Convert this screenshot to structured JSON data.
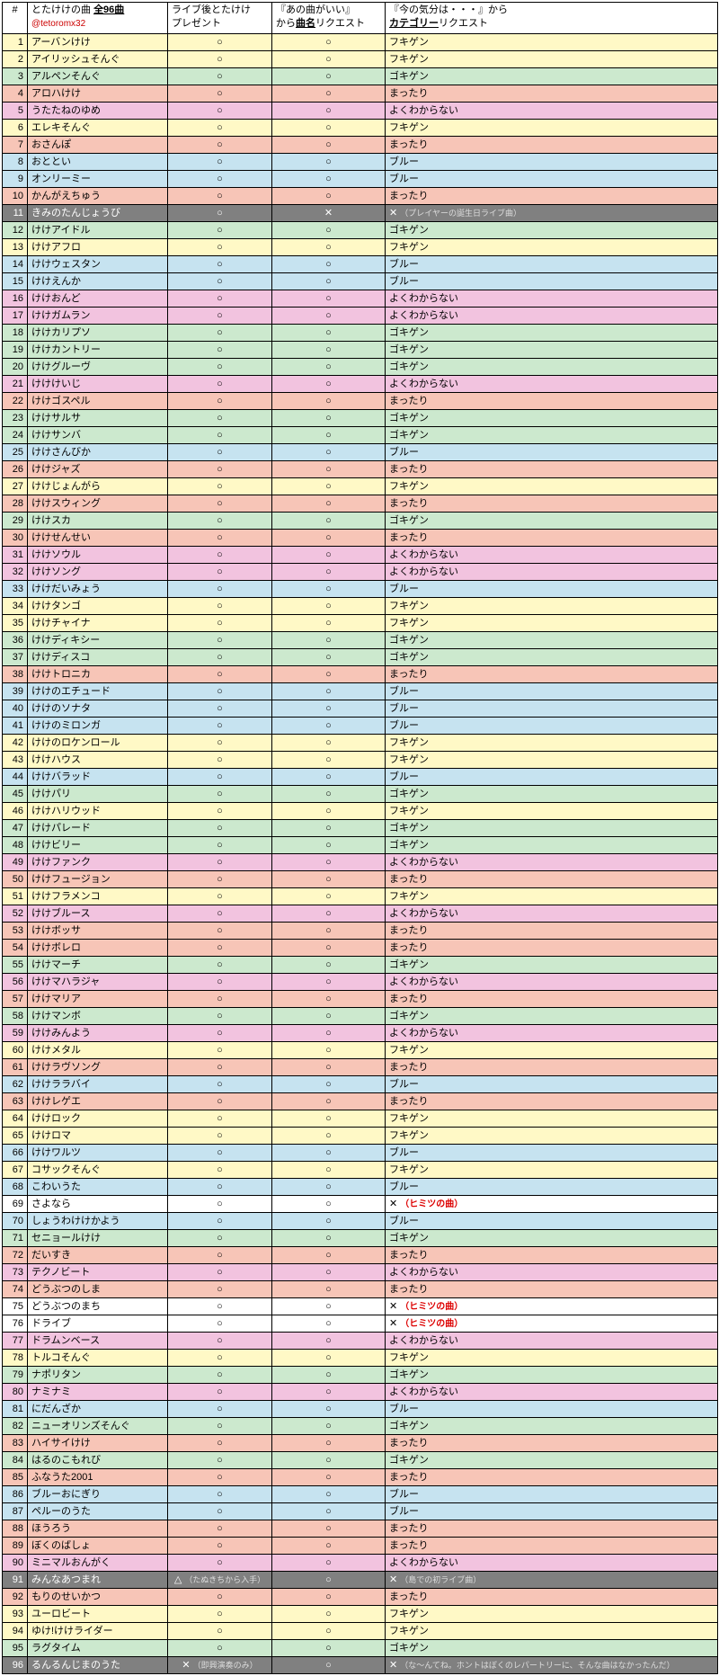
{
  "header": {
    "num": "#",
    "name_l1": "とたけけの曲 ",
    "name_bold": "全96曲",
    "credit": "@tetoromx32",
    "c1_l1": "ライブ後とたけけ",
    "c1_l2": "プレゼント",
    "c2_l1": "『あの曲がいい』",
    "c2_l2_pre": "から",
    "c2_l2_bold": "曲名",
    "c2_l2_post": "リクエスト",
    "c3_l1": "『今の気分は・・・』から",
    "c3_l2_bold": "カテゴリー",
    "c3_l2_post": "リクエスト"
  },
  "marks": {
    "circle": "○",
    "cross": "✕",
    "tri": "△"
  },
  "notes": {
    "birthday": "（プレイヤーの誕生日ライブ曲）",
    "secret": "（ヒミツの曲）",
    "tanuki": "（たぬきちから入手）",
    "first_live": "（島での初ライブ曲）",
    "improv": "（即興演奏のみ）",
    "repertoire": "（な～んてね。ホントはぼくのレパートリーに、そんな曲はなかったんだ）"
  },
  "rows": [
    {
      "n": "1",
      "name": "アーバンけけ",
      "c1": "c",
      "c2": "c",
      "c3": "フキゲン",
      "color": "yellow"
    },
    {
      "n": "2",
      "name": "アイリッシュそんぐ",
      "c1": "c",
      "c2": "c",
      "c3": "フキゲン",
      "color": "yellow"
    },
    {
      "n": "3",
      "name": "アルペンそんぐ",
      "c1": "c",
      "c2": "c",
      "c3": "ゴキゲン",
      "color": "green"
    },
    {
      "n": "4",
      "name": "アロハけけ",
      "c1": "c",
      "c2": "c",
      "c3": "まったり",
      "color": "red"
    },
    {
      "n": "5",
      "name": "うたたねのゆめ",
      "c1": "c",
      "c2": "c",
      "c3": "よくわからない",
      "color": "pink"
    },
    {
      "n": "6",
      "name": "エレキそんぐ",
      "c1": "c",
      "c2": "c",
      "c3": "フキゲン",
      "color": "yellow"
    },
    {
      "n": "7",
      "name": "おさんぽ",
      "c1": "c",
      "c2": "c",
      "c3": "まったり",
      "color": "red"
    },
    {
      "n": "8",
      "name": "おととい",
      "c1": "c",
      "c2": "c",
      "c3": "ブルー",
      "color": "blue"
    },
    {
      "n": "9",
      "name": "オンリーミー",
      "c1": "c",
      "c2": "c",
      "c3": "ブルー",
      "color": "blue"
    },
    {
      "n": "10",
      "name": "かんがえちゅう",
      "c1": "c",
      "c2": "c",
      "c3": "まったり",
      "color": "red"
    },
    {
      "n": "11",
      "name": "きみのたんじょうび",
      "c1": "c",
      "c2": "x",
      "c3": "✕",
      "note": "birthday",
      "color": "grey"
    },
    {
      "n": "12",
      "name": "けけアイドル",
      "c1": "c",
      "c2": "c",
      "c3": "ゴキゲン",
      "color": "green"
    },
    {
      "n": "13",
      "name": "けけアフロ",
      "c1": "c",
      "c2": "c",
      "c3": "フキゲン",
      "color": "yellow"
    },
    {
      "n": "14",
      "name": "けけウェスタン",
      "c1": "c",
      "c2": "c",
      "c3": "ブルー",
      "color": "blue"
    },
    {
      "n": "15",
      "name": "けけえんか",
      "c1": "c",
      "c2": "c",
      "c3": "ブルー",
      "color": "blue"
    },
    {
      "n": "16",
      "name": "けけおんど",
      "c1": "c",
      "c2": "c",
      "c3": "よくわからない",
      "color": "pink"
    },
    {
      "n": "17",
      "name": "けけガムラン",
      "c1": "c",
      "c2": "c",
      "c3": "よくわからない",
      "color": "pink"
    },
    {
      "n": "18",
      "name": "けけカリプソ",
      "c1": "c",
      "c2": "c",
      "c3": "ゴキゲン",
      "color": "green"
    },
    {
      "n": "19",
      "name": "けけカントリー",
      "c1": "c",
      "c2": "c",
      "c3": "ゴキゲン",
      "color": "green"
    },
    {
      "n": "20",
      "name": "けけグルーヴ",
      "c1": "c",
      "c2": "c",
      "c3": "ゴキゲン",
      "color": "green"
    },
    {
      "n": "21",
      "name": "けけけいじ",
      "c1": "c",
      "c2": "c",
      "c3": "よくわからない",
      "color": "pink"
    },
    {
      "n": "22",
      "name": "けけゴスペル",
      "c1": "c",
      "c2": "c",
      "c3": "まったり",
      "color": "red"
    },
    {
      "n": "23",
      "name": "けけサルサ",
      "c1": "c",
      "c2": "c",
      "c3": "ゴキゲン",
      "color": "green"
    },
    {
      "n": "24",
      "name": "けけサンバ",
      "c1": "c",
      "c2": "c",
      "c3": "ゴキゲン",
      "color": "green"
    },
    {
      "n": "25",
      "name": "けけさんびか",
      "c1": "c",
      "c2": "c",
      "c3": "ブルー",
      "color": "blue"
    },
    {
      "n": "26",
      "name": "けけジャズ",
      "c1": "c",
      "c2": "c",
      "c3": "まったり",
      "color": "red"
    },
    {
      "n": "27",
      "name": "けけじょんがら",
      "c1": "c",
      "c2": "c",
      "c3": "フキゲン",
      "color": "yellow"
    },
    {
      "n": "28",
      "name": "けけスウィング",
      "c1": "c",
      "c2": "c",
      "c3": "まったり",
      "color": "red"
    },
    {
      "n": "29",
      "name": "けけスカ",
      "c1": "c",
      "c2": "c",
      "c3": "ゴキゲン",
      "color": "green"
    },
    {
      "n": "30",
      "name": "けけせんせい",
      "c1": "c",
      "c2": "c",
      "c3": "まったり",
      "color": "red"
    },
    {
      "n": "31",
      "name": "けけソウル",
      "c1": "c",
      "c2": "c",
      "c3": "よくわからない",
      "color": "pink"
    },
    {
      "n": "32",
      "name": "けけソング",
      "c1": "c",
      "c2": "c",
      "c3": "よくわからない",
      "color": "pink"
    },
    {
      "n": "33",
      "name": "けけだいみょう",
      "c1": "c",
      "c2": "c",
      "c3": "ブルー",
      "color": "blue"
    },
    {
      "n": "34",
      "name": "けけタンゴ",
      "c1": "c",
      "c2": "c",
      "c3": "フキゲン",
      "color": "yellow"
    },
    {
      "n": "35",
      "name": "けけチャイナ",
      "c1": "c",
      "c2": "c",
      "c3": "フキゲン",
      "color": "yellow"
    },
    {
      "n": "36",
      "name": "けけディキシー",
      "c1": "c",
      "c2": "c",
      "c3": "ゴキゲン",
      "color": "green"
    },
    {
      "n": "37",
      "name": "けけディスコ",
      "c1": "c",
      "c2": "c",
      "c3": "ゴキゲン",
      "color": "green"
    },
    {
      "n": "38",
      "name": "けけトロニカ",
      "c1": "c",
      "c2": "c",
      "c3": "まったり",
      "color": "red"
    },
    {
      "n": "39",
      "name": "けけのエチュード",
      "c1": "c",
      "c2": "c",
      "c3": "ブルー",
      "color": "blue"
    },
    {
      "n": "40",
      "name": "けけのソナタ",
      "c1": "c",
      "c2": "c",
      "c3": "ブルー",
      "color": "blue"
    },
    {
      "n": "41",
      "name": "けけのミロンガ",
      "c1": "c",
      "c2": "c",
      "c3": "ブルー",
      "color": "blue"
    },
    {
      "n": "42",
      "name": "けけのロケンロール",
      "c1": "c",
      "c2": "c",
      "c3": "フキゲン",
      "color": "yellow"
    },
    {
      "n": "43",
      "name": "けけハウス",
      "c1": "c",
      "c2": "c",
      "c3": "フキゲン",
      "color": "yellow"
    },
    {
      "n": "44",
      "name": "けけバラッド",
      "c1": "c",
      "c2": "c",
      "c3": "ブルー",
      "color": "blue"
    },
    {
      "n": "45",
      "name": "けけパリ",
      "c1": "c",
      "c2": "c",
      "c3": "ゴキゲン",
      "color": "green"
    },
    {
      "n": "46",
      "name": "けけハリウッド",
      "c1": "c",
      "c2": "c",
      "c3": "フキゲン",
      "color": "yellow"
    },
    {
      "n": "47",
      "name": "けけパレード",
      "c1": "c",
      "c2": "c",
      "c3": "ゴキゲン",
      "color": "green"
    },
    {
      "n": "48",
      "name": "けけビリー",
      "c1": "c",
      "c2": "c",
      "c3": "ゴキゲン",
      "color": "green"
    },
    {
      "n": "49",
      "name": "けけファンク",
      "c1": "c",
      "c2": "c",
      "c3": "よくわからない",
      "color": "pink"
    },
    {
      "n": "50",
      "name": "けけフュージョン",
      "c1": "c",
      "c2": "c",
      "c3": "まったり",
      "color": "red"
    },
    {
      "n": "51",
      "name": "けけフラメンコ",
      "c1": "c",
      "c2": "c",
      "c3": "フキゲン",
      "color": "yellow"
    },
    {
      "n": "52",
      "name": "けけブルース",
      "c1": "c",
      "c2": "c",
      "c3": "よくわからない",
      "color": "pink"
    },
    {
      "n": "53",
      "name": "けけボッサ",
      "c1": "c",
      "c2": "c",
      "c3": "まったり",
      "color": "red"
    },
    {
      "n": "54",
      "name": "けけボレロ",
      "c1": "c",
      "c2": "c",
      "c3": "まったり",
      "color": "red"
    },
    {
      "n": "55",
      "name": "けけマーチ",
      "c1": "c",
      "c2": "c",
      "c3": "ゴキゲン",
      "color": "green"
    },
    {
      "n": "56",
      "name": "けけマハラジャ",
      "c1": "c",
      "c2": "c",
      "c3": "よくわからない",
      "color": "pink"
    },
    {
      "n": "57",
      "name": "けけマリア",
      "c1": "c",
      "c2": "c",
      "c3": "まったり",
      "color": "red"
    },
    {
      "n": "58",
      "name": "けけマンボ",
      "c1": "c",
      "c2": "c",
      "c3": "ゴキゲン",
      "color": "green"
    },
    {
      "n": "59",
      "name": "けけみんよう",
      "c1": "c",
      "c2": "c",
      "c3": "よくわからない",
      "color": "pink"
    },
    {
      "n": "60",
      "name": "けけメタル",
      "c1": "c",
      "c2": "c",
      "c3": "フキゲン",
      "color": "yellow"
    },
    {
      "n": "61",
      "name": "けけラヴソング",
      "c1": "c",
      "c2": "c",
      "c3": "まったり",
      "color": "red"
    },
    {
      "n": "62",
      "name": "けけララバイ",
      "c1": "c",
      "c2": "c",
      "c3": "ブルー",
      "color": "blue"
    },
    {
      "n": "63",
      "name": "けけレゲエ",
      "c1": "c",
      "c2": "c",
      "c3": "まったり",
      "color": "red"
    },
    {
      "n": "64",
      "name": "けけロック",
      "c1": "c",
      "c2": "c",
      "c3": "フキゲン",
      "color": "yellow"
    },
    {
      "n": "65",
      "name": "けけロマ",
      "c1": "c",
      "c2": "c",
      "c3": "フキゲン",
      "color": "yellow"
    },
    {
      "n": "66",
      "name": "けけワルツ",
      "c1": "c",
      "c2": "c",
      "c3": "ブルー",
      "color": "blue"
    },
    {
      "n": "67",
      "name": "コサックそんぐ",
      "c1": "c",
      "c2": "c",
      "c3": "フキゲン",
      "color": "yellow"
    },
    {
      "n": "68",
      "name": "こわいうた",
      "c1": "c",
      "c2": "c",
      "c3": "ブルー",
      "color": "blue"
    },
    {
      "n": "69",
      "name": "さよなら",
      "c1": "c",
      "c2": "c",
      "c3": "✕",
      "note": "secret",
      "color": "white"
    },
    {
      "n": "70",
      "name": "しょうわけけかよう",
      "c1": "c",
      "c2": "c",
      "c3": "ブルー",
      "color": "blue"
    },
    {
      "n": "71",
      "name": "セニョールけけ",
      "c1": "c",
      "c2": "c",
      "c3": "ゴキゲン",
      "color": "green"
    },
    {
      "n": "72",
      "name": "だいすき",
      "c1": "c",
      "c2": "c",
      "c3": "まったり",
      "color": "red"
    },
    {
      "n": "73",
      "name": "テクノビート",
      "c1": "c",
      "c2": "c",
      "c3": "よくわからない",
      "color": "pink"
    },
    {
      "n": "74",
      "name": "どうぶつのしま",
      "c1": "c",
      "c2": "c",
      "c3": "まったり",
      "color": "red"
    },
    {
      "n": "75",
      "name": "どうぶつのまち",
      "c1": "c",
      "c2": "c",
      "c3": "✕",
      "note": "secret",
      "color": "white"
    },
    {
      "n": "76",
      "name": "ドライブ",
      "c1": "c",
      "c2": "c",
      "c3": "✕",
      "note": "secret",
      "color": "white"
    },
    {
      "n": "77",
      "name": "ドラムンベース",
      "c1": "c",
      "c2": "c",
      "c3": "よくわからない",
      "color": "pink"
    },
    {
      "n": "78",
      "name": "トルコそんぐ",
      "c1": "c",
      "c2": "c",
      "c3": "フキゲン",
      "color": "yellow"
    },
    {
      "n": "79",
      "name": "ナポリタン",
      "c1": "c",
      "c2": "c",
      "c3": "ゴキゲン",
      "color": "green"
    },
    {
      "n": "80",
      "name": "ナミナミ",
      "c1": "c",
      "c2": "c",
      "c3": "よくわからない",
      "color": "pink"
    },
    {
      "n": "81",
      "name": "にだんざか",
      "c1": "c",
      "c2": "c",
      "c3": "ブルー",
      "color": "blue"
    },
    {
      "n": "82",
      "name": "ニューオリンズそんぐ",
      "c1": "c",
      "c2": "c",
      "c3": "ゴキゲン",
      "color": "green"
    },
    {
      "n": "83",
      "name": "ハイサイけけ",
      "c1": "c",
      "c2": "c",
      "c3": "まったり",
      "color": "red"
    },
    {
      "n": "84",
      "name": "はるのこもれび",
      "c1": "c",
      "c2": "c",
      "c3": "ゴキゲン",
      "color": "green"
    },
    {
      "n": "85",
      "name": "ふなうた2001",
      "c1": "c",
      "c2": "c",
      "c3": "まったり",
      "color": "red"
    },
    {
      "n": "86",
      "name": "ブルーおにぎり",
      "c1": "c",
      "c2": "c",
      "c3": "ブルー",
      "color": "blue"
    },
    {
      "n": "87",
      "name": "ペルーのうた",
      "c1": "c",
      "c2": "c",
      "c3": "ブルー",
      "color": "blue"
    },
    {
      "n": "88",
      "name": "ほうろう",
      "c1": "c",
      "c2": "c",
      "c3": "まったり",
      "color": "red"
    },
    {
      "n": "89",
      "name": "ぼくのばしょ",
      "c1": "c",
      "c2": "c",
      "c3": "まったり",
      "color": "red"
    },
    {
      "n": "90",
      "name": "ミニマルおんがく",
      "c1": "c",
      "c2": "c",
      "c3": "よくわからない",
      "color": "pink"
    },
    {
      "n": "91",
      "name": "みんなあつまれ",
      "c1": "t",
      "c1note": "tanuki",
      "c2": "c",
      "c3": "✕",
      "note": "first_live",
      "color": "grey"
    },
    {
      "n": "92",
      "name": "もりのせいかつ",
      "c1": "c",
      "c2": "c",
      "c3": "まったり",
      "color": "red"
    },
    {
      "n": "93",
      "name": "ユーロビート",
      "c1": "c",
      "c2": "c",
      "c3": "フキゲン",
      "color": "yellow"
    },
    {
      "n": "94",
      "name": "ゆけ!けけライダー",
      "c1": "c",
      "c2": "c",
      "c3": "フキゲン",
      "color": "yellow"
    },
    {
      "n": "95",
      "name": "ラグタイム",
      "c1": "c",
      "c2": "c",
      "c3": "ゴキゲン",
      "color": "green"
    },
    {
      "n": "96",
      "name": "るんるんじまのうた",
      "c1": "x",
      "c1note": "improv",
      "c2": "c",
      "c3": "✕",
      "note": "repertoire",
      "color": "grey"
    }
  ]
}
